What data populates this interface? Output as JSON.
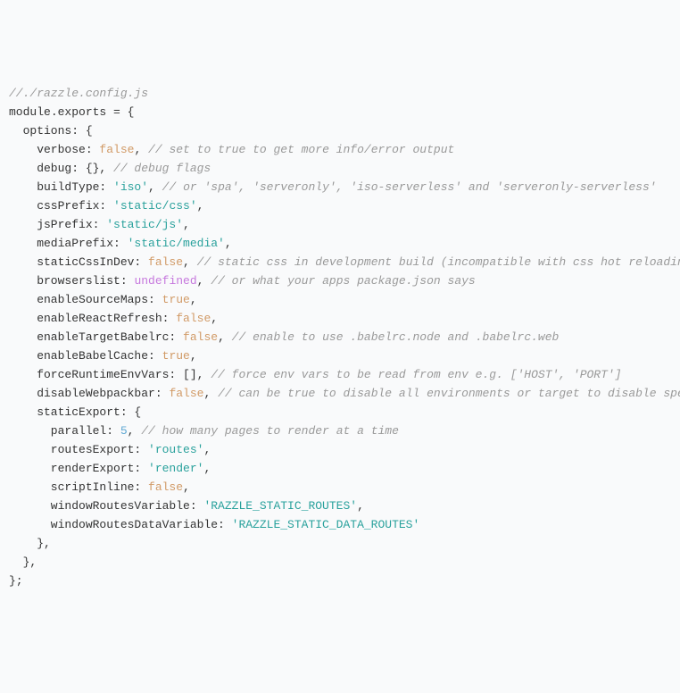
{
  "code": {
    "line1_comment": "//./razzle.config.js",
    "line2_module": "module",
    "line2_exports": ".exports = {",
    "line3_options": "  options: {",
    "line4_key": "    verbose: ",
    "line4_val": "false",
    "line4_comma": ",",
    "line4_comment": " // set to true to get more info/error output",
    "line5_key": "    debug: {},",
    "line5_comment": " // debug flags",
    "line6_key": "    buildType: ",
    "line6_val": "'iso'",
    "line6_comma": ",",
    "line6_comment": " // or 'spa', 'serveronly', 'iso-serverless' and 'serveronly-serverless'",
    "line7_key": "    cssPrefix: ",
    "line7_val": "'static/css'",
    "line7_comma": ",",
    "line8_key": "    jsPrefix: ",
    "line8_val": "'static/js'",
    "line8_comma": ",",
    "line9_key": "    mediaPrefix: ",
    "line9_val": "'static/media'",
    "line9_comma": ",",
    "line10_key": "    staticCssInDev: ",
    "line10_val": "false",
    "line10_comma": ",",
    "line10_comment": " // static css in development build (incompatible with css hot reloading",
    "line11_key": "    browserslist: ",
    "line11_val": "undefined",
    "line11_comma": ",",
    "line11_comment": " // or what your apps package.json says",
    "line12_key": "    enableSourceMaps: ",
    "line12_val": "true",
    "line12_comma": ",",
    "line13_key": "    enableReactRefresh: ",
    "line13_val": "false",
    "line13_comma": ",",
    "line14_key": "    enableTargetBabelrc: ",
    "line14_val": "false",
    "line14_comma": ",",
    "line14_comment": " // enable to use .babelrc.node and .babelrc.web",
    "line15_key": "    enableBabelCache: ",
    "line15_val": "true",
    "line15_comma": ",",
    "line16_key": "    forceRuntimeEnvVars: [],",
    "line16_comment": " // force env vars to be read from env e.g. ['HOST', 'PORT']",
    "line17_key": "    disableWebpackbar: ",
    "line17_val": "false",
    "line17_comma": ",",
    "line17_comment": " // can be true to disable all environments or target to disable spe",
    "line18": "    staticExport: {",
    "line19_key": "      parallel: ",
    "line19_val": "5",
    "line19_comma": ",",
    "line19_comment": " // how many pages to render at a time",
    "line20_key": "      routesExport: ",
    "line20_val": "'routes'",
    "line20_comma": ",",
    "line21_key": "      renderExport: ",
    "line21_val": "'render'",
    "line21_comma": ",",
    "line22_key": "      scriptInline: ",
    "line22_val": "false",
    "line22_comma": ",",
    "line23_key": "      windowRoutesVariable: ",
    "line23_val": "'RAZZLE_STATIC_ROUTES'",
    "line23_comma": ",",
    "line24_key": "      windowRoutesDataVariable: ",
    "line24_val": "'RAZZLE_STATIC_DATA_ROUTES'",
    "line25": "    },",
    "line26": "  },",
    "line27": "};"
  }
}
